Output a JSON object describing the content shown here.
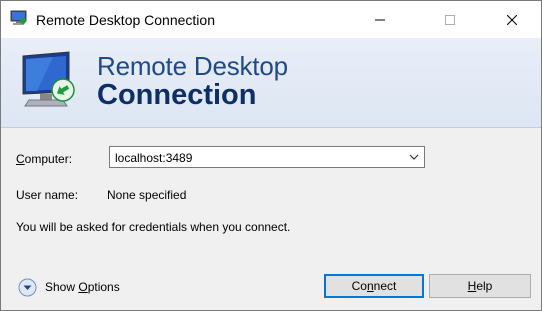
{
  "window": {
    "title": "Remote Desktop Connection"
  },
  "banner": {
    "line1": "Remote Desktop",
    "line2": "Connection"
  },
  "form": {
    "computer_label_pre": "C",
    "computer_label_post": "omputer:",
    "computer_value": "localhost:3489",
    "username_label": "User name:",
    "username_value": "None specified",
    "credentials_note": "You will be asked for credentials when you connect."
  },
  "footer": {
    "show_options_pre": "Show ",
    "show_options_u": "O",
    "show_options_post": "ptions",
    "connect_pre": "Co",
    "connect_u": "n",
    "connect_post": "nect",
    "help_u": "H",
    "help_post": "elp"
  },
  "icons": {
    "app": "remote-desktop-icon",
    "banner": "monitor-icon",
    "dropdown": "chevron-down-icon",
    "show_options": "expand-circle-icon"
  },
  "colors": {
    "accent": "#0078d7",
    "banner_title": "#0e2f66"
  }
}
